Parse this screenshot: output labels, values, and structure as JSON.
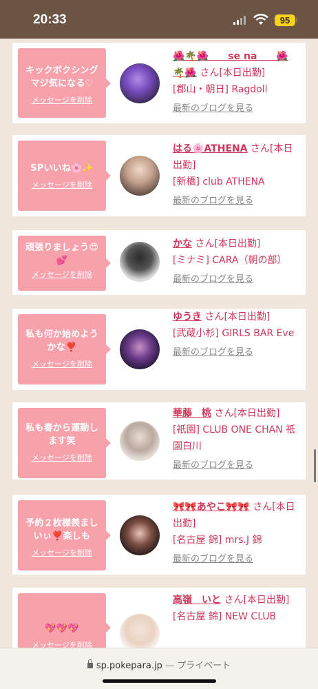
{
  "status": {
    "time": "20:33",
    "battery": "95"
  },
  "delete_label": "メッセージを削除",
  "san_label": "さん",
  "blog_label": "最新のブログを見る",
  "cards": [
    {
      "message": "キックボクシング\nマジ気になる♡",
      "name": "🌺🌴🌺　　se na　　🌺\n🌴🌺",
      "status": "[本日出勤]",
      "shop": "[郡山・朝日] Ragdoll"
    },
    {
      "message": "SPいいね🌸✨",
      "name": "はる🌸ATHENA",
      "status": "[本日出勤]",
      "shop": "[新橋] club ATHENA"
    },
    {
      "message": "頑張りましょう😍\n💕",
      "name": "かな",
      "status": "[本日出勤]",
      "shop": "[ミナミ] CARA（朝の部）"
    },
    {
      "message": "私も何か始めよう\nかな❣️",
      "name": "ゆうき",
      "status": "[本日出勤]",
      "shop": "[武蔵小杉] GIRLS BAR Eve"
    },
    {
      "message": "私も春から運動し\nます笑",
      "name": "華藤　桃",
      "status": "[本日出勤]",
      "shop": "[祇園] CLUB ONE CHAN 祇園白川"
    },
    {
      "message": "予約２枚様羨まし\nいぃ❣️楽しも",
      "name": "🎀🎀あやこ🎀🎀",
      "status": "[本日出勤]",
      "shop": "[名古屋 錦] mrs.J 錦"
    },
    {
      "message": "💖💖💖",
      "name": "高嶺　いと",
      "status": "[本日出勤]",
      "shop": "[名古屋 錦] NEW CLUB"
    }
  ],
  "url_bar": {
    "domain": "sp.pokepara.jp",
    "mode": "— プライベート"
  },
  "colors": {
    "accent": "#d1365a",
    "bubble": "#f7a1ab",
    "status_bar": "#6b5443"
  }
}
